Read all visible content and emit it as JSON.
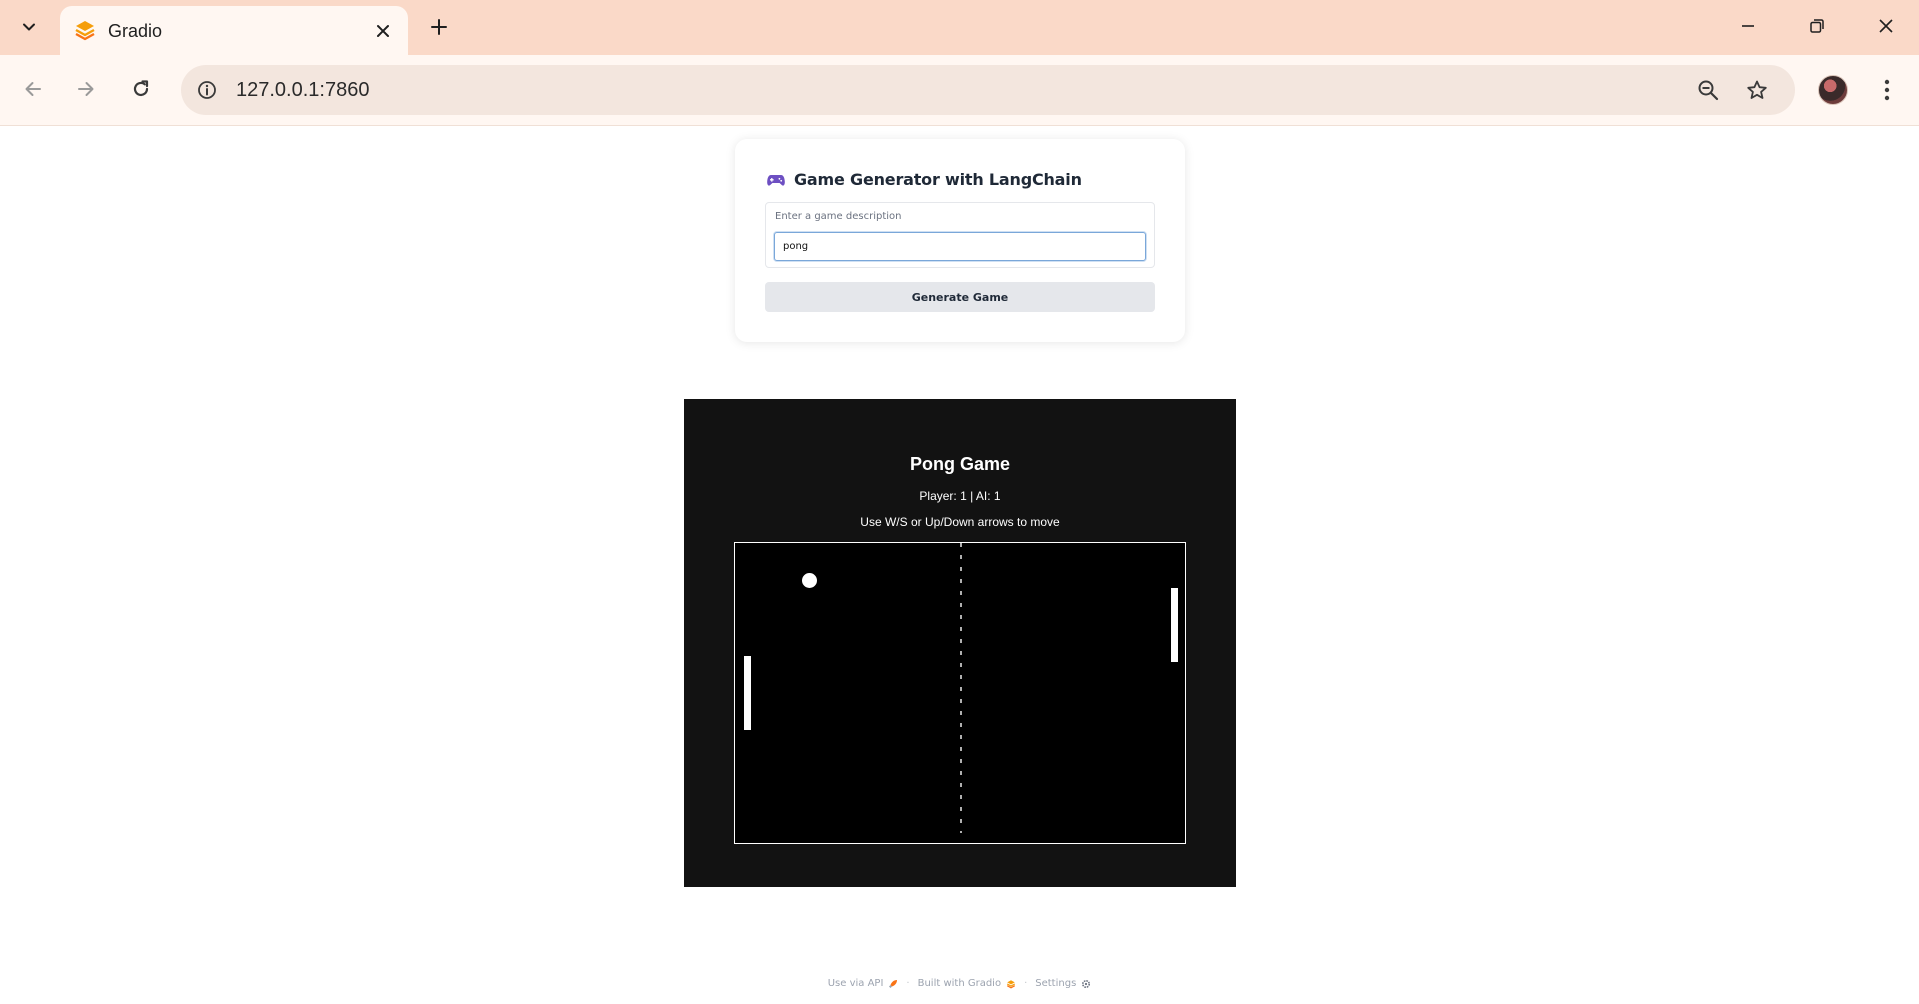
{
  "browser": {
    "tab_title": "Gradio",
    "url": "127.0.0.1:7860",
    "icons": {
      "tab_search": "chevron-down-icon",
      "favicon": "gradio-logo-icon",
      "tab_close": "close-icon",
      "new_tab": "plus-icon",
      "minimize": "minimize-icon",
      "restore": "restore-icon",
      "close_window": "close-icon",
      "back": "arrow-left-icon",
      "forward": "arrow-right-icon",
      "reload": "reload-icon",
      "site_info": "info-icon",
      "zoom": "zoom-out-icon",
      "bookmark": "star-icon",
      "profile": "avatar",
      "menu": "kebab-menu-icon"
    },
    "colors": {
      "tab_strip": "#fad9c8",
      "toolbar": "#fff7f2",
      "omnibox": "#f3e6de"
    }
  },
  "app": {
    "title": "Game Generator with LangChain",
    "title_icon": "gamepad-icon",
    "input_label": "Enter a game description",
    "input_value": "pong",
    "generate_button": "Generate Game"
  },
  "game": {
    "title": "Pong Game",
    "score": "Player: 1 | AI: 1",
    "instructions": "Use W/S or Up/Down arrows to move",
    "colors": {
      "frame_bg": "#121212",
      "canvas_bg": "#000000",
      "pieces": "#ffffff"
    }
  },
  "footer": {
    "api": "Use via API",
    "api_icon": "rocket-icon",
    "built": "Built with Gradio",
    "built_icon": "gradio-logo-icon",
    "settings": "Settings",
    "settings_icon": "gear-icon",
    "separator": "·"
  }
}
